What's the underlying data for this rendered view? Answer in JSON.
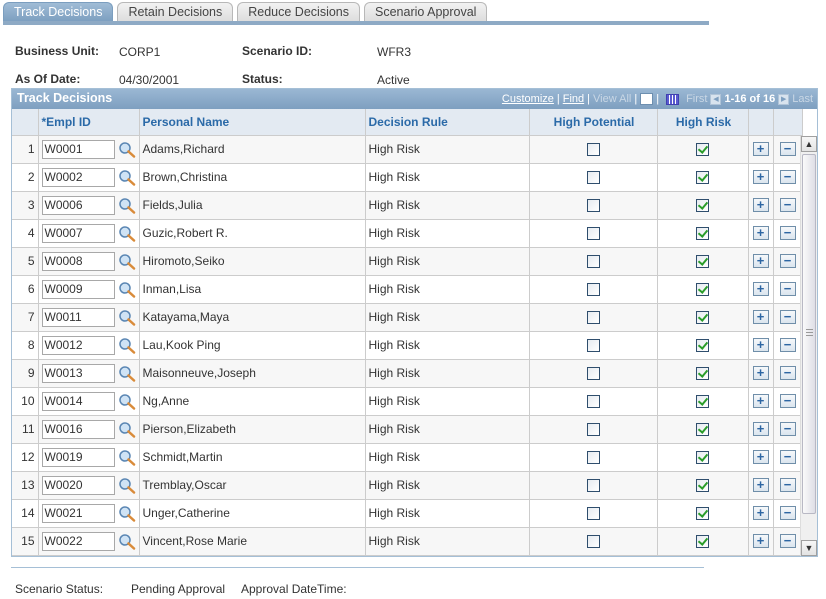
{
  "tabs": [
    {
      "label": "Track Decisions",
      "active": true
    },
    {
      "label": "Retain Decisions",
      "active": false
    },
    {
      "label": "Reduce Decisions",
      "active": false
    },
    {
      "label": "Scenario Approval",
      "active": false
    }
  ],
  "header": {
    "business_unit_label": "Business Unit:",
    "business_unit": "CORP1",
    "scenario_id_label": "Scenario ID:",
    "scenario_id": "WFR3",
    "as_of_date_label": "As Of Date:",
    "as_of_date": "04/30/2001",
    "status_label": "Status:",
    "status": "Active"
  },
  "grid": {
    "title": "Track Decisions",
    "nav": {
      "customize": "Customize",
      "find": "Find",
      "view_all": "View All",
      "first": "First",
      "range": "1-16 of 16",
      "last": "Last"
    },
    "columns": {
      "empl_id": "*Empl ID",
      "name": "Personal Name",
      "rule": "Decision Rule",
      "high_potential": "High Potential",
      "high_risk": "High Risk"
    },
    "rows": [
      {
        "n": "1",
        "id": "W0001",
        "name": "Adams,Richard",
        "rule": "High Risk",
        "hp": false,
        "hr": true
      },
      {
        "n": "2",
        "id": "W0002",
        "name": "Brown,Christina",
        "rule": "High Risk",
        "hp": false,
        "hr": true
      },
      {
        "n": "3",
        "id": "W0006",
        "name": "Fields,Julia",
        "rule": "High Risk",
        "hp": false,
        "hr": true
      },
      {
        "n": "4",
        "id": "W0007",
        "name": "Guzic,Robert R.",
        "rule": "High Risk",
        "hp": false,
        "hr": true
      },
      {
        "n": "5",
        "id": "W0008",
        "name": "Hiromoto,Seiko",
        "rule": "High Risk",
        "hp": false,
        "hr": true
      },
      {
        "n": "6",
        "id": "W0009",
        "name": "Inman,Lisa",
        "rule": "High Risk",
        "hp": false,
        "hr": true
      },
      {
        "n": "7",
        "id": "W0011",
        "name": "Katayama,Maya",
        "rule": "High Risk",
        "hp": false,
        "hr": true
      },
      {
        "n": "8",
        "id": "W0012",
        "name": "Lau,Kook Ping",
        "rule": "High Risk",
        "hp": false,
        "hr": true
      },
      {
        "n": "9",
        "id": "W0013",
        "name": "Maisonneuve,Joseph",
        "rule": "High Risk",
        "hp": false,
        "hr": true
      },
      {
        "n": "10",
        "id": "W0014",
        "name": "Ng,Anne",
        "rule": "High Risk",
        "hp": false,
        "hr": true
      },
      {
        "n": "11",
        "id": "W0016",
        "name": "Pierson,Elizabeth",
        "rule": "High Risk",
        "hp": false,
        "hr": true
      },
      {
        "n": "12",
        "id": "W0019",
        "name": "Schmidt,Martin",
        "rule": "High Risk",
        "hp": false,
        "hr": true
      },
      {
        "n": "13",
        "id": "W0020",
        "name": "Tremblay,Oscar",
        "rule": "High Risk",
        "hp": false,
        "hr": true
      },
      {
        "n": "14",
        "id": "W0021",
        "name": "Unger,Catherine",
        "rule": "High Risk",
        "hp": false,
        "hr": true
      },
      {
        "n": "15",
        "id": "W0022",
        "name": "Vincent,Rose Marie",
        "rule": "High Risk",
        "hp": false,
        "hr": true
      }
    ]
  },
  "footer": {
    "scenario_status_label": "Scenario Status:",
    "scenario_status": "Pending Approval",
    "approval_datetime_label": "Approval DateTime:",
    "approval_datetime": ""
  },
  "icons": {
    "lookup": "magnifier-icon",
    "add_row": "+",
    "delete_row": "−",
    "scroll_up": "^",
    "scroll_down": "v"
  }
}
